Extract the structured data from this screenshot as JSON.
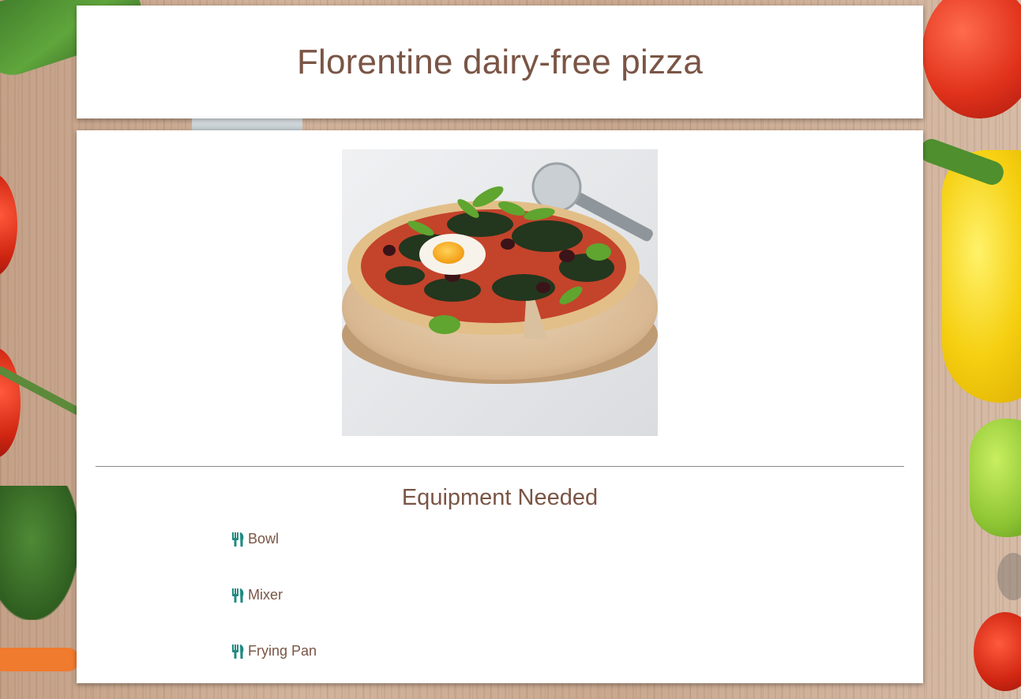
{
  "header": {
    "title": "Florentine dairy-free pizza"
  },
  "recipe": {
    "image_icon": "pizza-photo"
  },
  "equipment": {
    "heading": "Equipment Needed",
    "icon": "utensils-icon",
    "icon_color": "#1f8a82",
    "items": [
      {
        "label": "Bowl"
      },
      {
        "label": "Mixer"
      },
      {
        "label": "Frying Pan"
      }
    ]
  },
  "colors": {
    "title_text": "#7a5545",
    "card_background": "#ffffff",
    "icon_teal": "#1f8a82"
  }
}
